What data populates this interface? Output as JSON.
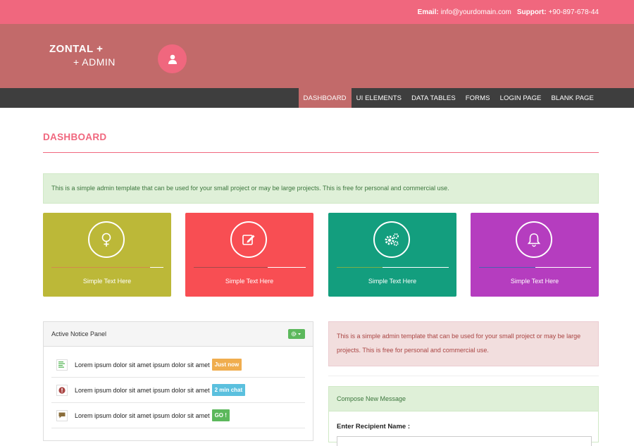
{
  "topbar": {
    "email_label": "Email:",
    "email_value": "info@yourdomain.com",
    "support_label": "Support:",
    "support_value": "+90-897-678-44"
  },
  "brand": {
    "line1": "ZONTAL +",
    "line2": "+ ADMIN",
    "avatar_icon": "user-icon"
  },
  "nav": {
    "items": [
      {
        "label": "DASHBOARD",
        "active": true
      },
      {
        "label": "UI ELEMENTS",
        "active": false
      },
      {
        "label": "DATA TABLES",
        "active": false
      },
      {
        "label": "FORMS",
        "active": false
      },
      {
        "label": "LOGIN PAGE",
        "active": false
      },
      {
        "label": "BLANK PAGE",
        "active": false
      }
    ]
  },
  "page": {
    "title": "DASHBOARD",
    "alert_success": "This is a simple admin template that can be used for your small project or may be large projects. This is free for personal and commercial use."
  },
  "tiles": [
    {
      "icon": "female-icon",
      "caption": "Simple Text Here",
      "color": "#bcb838",
      "progress_color": "#d28b4b",
      "progress": 0.88
    },
    {
      "icon": "edit-icon",
      "caption": "Simple Text Here",
      "color": "#f84e53",
      "progress_color": "#a34a4a",
      "progress": 0.66
    },
    {
      "icon": "gears-icon",
      "caption": "Simple Text Here",
      "color": "#139e7e",
      "progress_color": "#7ab04a",
      "progress": 0.41
    },
    {
      "icon": "bell-icon",
      "caption": "Simple Text Here",
      "color": "#b53dbf",
      "progress_color": "#4a5fb0",
      "progress": 0.5
    }
  ],
  "notice_panel": {
    "title": "Active Notice Panel",
    "settings_icon": "gear-icon",
    "items": [
      {
        "icon": "list-icon",
        "text": "Lorem ipsum dolor sit amet ipsum dolor sit amet",
        "badge": "Just now",
        "badge_color": "#f0ad4e"
      },
      {
        "icon": "info-icon",
        "text": "Lorem ipsum dolor sit amet ipsum dolor sit amet",
        "badge": "2 min chat",
        "badge_color": "#5bc0de"
      },
      {
        "icon": "comment-icon",
        "text": "Lorem ipsum dolor sit amet ipsum dolor sit amet",
        "badge": "GO !",
        "badge_color": "#5cb85c"
      }
    ]
  },
  "alert_danger": "This is a simple admin template that can be used for your small project or may be large projects. This is free for personal and commercial use.",
  "compose": {
    "title": "Compose New Message",
    "recipient_label": "Enter Recipient Name :",
    "recipient_value": ""
  }
}
